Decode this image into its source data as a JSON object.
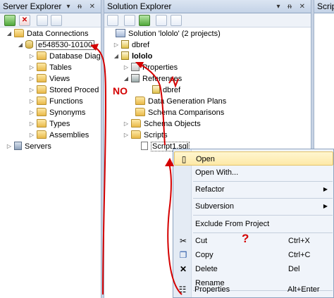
{
  "server_explorer": {
    "title": "Server Explorer",
    "title_buttons": "▾ ᵰ ✕",
    "tree": [
      {
        "label": "Data Connections",
        "expander": "◢"
      },
      {
        "label": "e548530-10100",
        "expander": "◢"
      },
      {
        "label": "Database Diag",
        "expander": "▷"
      },
      {
        "label": "Tables",
        "expander": "▷"
      },
      {
        "label": "Views",
        "expander": "▷"
      },
      {
        "label": "Stored Proced",
        "expander": "▷"
      },
      {
        "label": "Functions",
        "expander": "▷"
      },
      {
        "label": "Synonyms",
        "expander": "▷"
      },
      {
        "label": "Types",
        "expander": "▷"
      },
      {
        "label": "Assemblies",
        "expander": "▷"
      },
      {
        "label": "Servers",
        "expander": "▷"
      }
    ]
  },
  "solution_explorer": {
    "title": "Solution Explorer",
    "title_buttons": "▾ ᵰ ✕",
    "tree": [
      {
        "label": "Solution 'lololo' (2 projects)",
        "expander": ""
      },
      {
        "label": "dbref",
        "expander": "▷"
      },
      {
        "label": "lololo",
        "expander": "◢"
      },
      {
        "label": "Properties",
        "expander": "▷"
      },
      {
        "label": "References",
        "expander": "◢"
      },
      {
        "label": "dbref",
        "expander": ""
      },
      {
        "label": "Data Generation Plans",
        "expander": ""
      },
      {
        "label": "Schema Comparisons",
        "expander": ""
      },
      {
        "label": "Schema Objects",
        "expander": "▷"
      },
      {
        "label": "Scripts",
        "expander": "▷"
      },
      {
        "label": "Script1.sql",
        "expander": ""
      }
    ]
  },
  "third_pane": {
    "title": "Script"
  },
  "context_menu": {
    "items": [
      {
        "label": "Open",
        "shortcut": "",
        "icon": "▯"
      },
      {
        "label": "Open With...",
        "shortcut": "",
        "icon": ""
      },
      {
        "label": "Refactor",
        "shortcut": "",
        "icon": "",
        "submenu": "▶"
      },
      {
        "label": "Subversion",
        "shortcut": "",
        "icon": "",
        "submenu": "▶"
      },
      {
        "label": "Exclude From Project",
        "shortcut": "",
        "icon": ""
      },
      {
        "label": "Cut",
        "shortcut": "Ctrl+X",
        "icon": "✂"
      },
      {
        "label": "Copy",
        "shortcut": "Ctrl+C",
        "icon": "❐"
      },
      {
        "label": "Delete",
        "shortcut": "Del",
        "icon": "✕"
      },
      {
        "label": "Rename",
        "shortcut": "",
        "icon": ""
      },
      {
        "label": "Properties",
        "shortcut": "Alt+Enter",
        "icon": "☷"
      }
    ]
  },
  "annotations": {
    "no_label": "NO",
    "question_mark": "?",
    "ink_color": "#d40000"
  }
}
